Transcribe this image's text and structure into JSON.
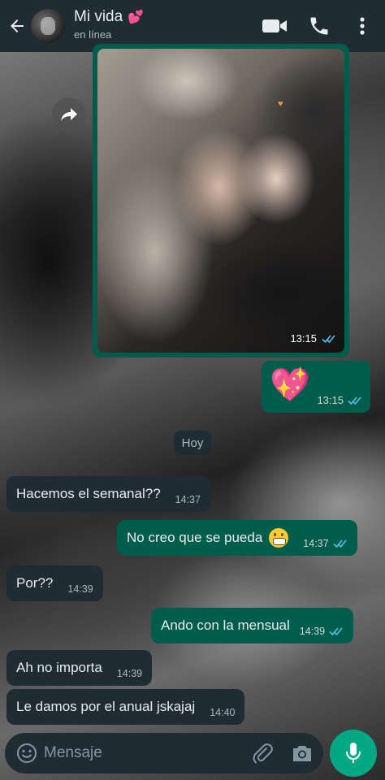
{
  "header": {
    "contact_name": "Mi vida",
    "name_emoji": "💕",
    "status": "en línea",
    "icons": [
      "back-arrow-icon",
      "video-call-icon",
      "voice-call-icon",
      "more-options-icon"
    ]
  },
  "messages": {
    "image": {
      "time": "13:15",
      "status": "read"
    },
    "emoji": {
      "content": "💖",
      "time": "13:15",
      "status": "read"
    },
    "date_chip": "Hoy",
    "m1": {
      "text": "Hacemos el semanal??",
      "time": "14:37",
      "direction": "incoming"
    },
    "m2": {
      "text": "No creo que se pueda",
      "emoji": "😬",
      "time": "14:37",
      "direction": "outgoing",
      "status": "read"
    },
    "m3": {
      "text": "Por??",
      "time": "14:39",
      "direction": "incoming"
    },
    "m4": {
      "text": "Ando con la mensual",
      "time": "14:39",
      "direction": "outgoing",
      "status": "read"
    },
    "m5": {
      "text": "Ah no importa",
      "time": "14:39",
      "direction": "incoming"
    },
    "m6": {
      "text": "Le damos por el anual jskajaj",
      "time": "14:40",
      "direction": "incoming"
    }
  },
  "composer": {
    "placeholder": "Mensaje",
    "icons": [
      "emoji-icon",
      "attach-icon",
      "camera-icon",
      "mic-icon"
    ]
  },
  "colors": {
    "header_bg": "#1f2c34",
    "outgoing_bubble": "#005c4b",
    "incoming_bubble": "#1f2c34",
    "read_ticks": "#53bdeb",
    "accent": "#00a884"
  }
}
